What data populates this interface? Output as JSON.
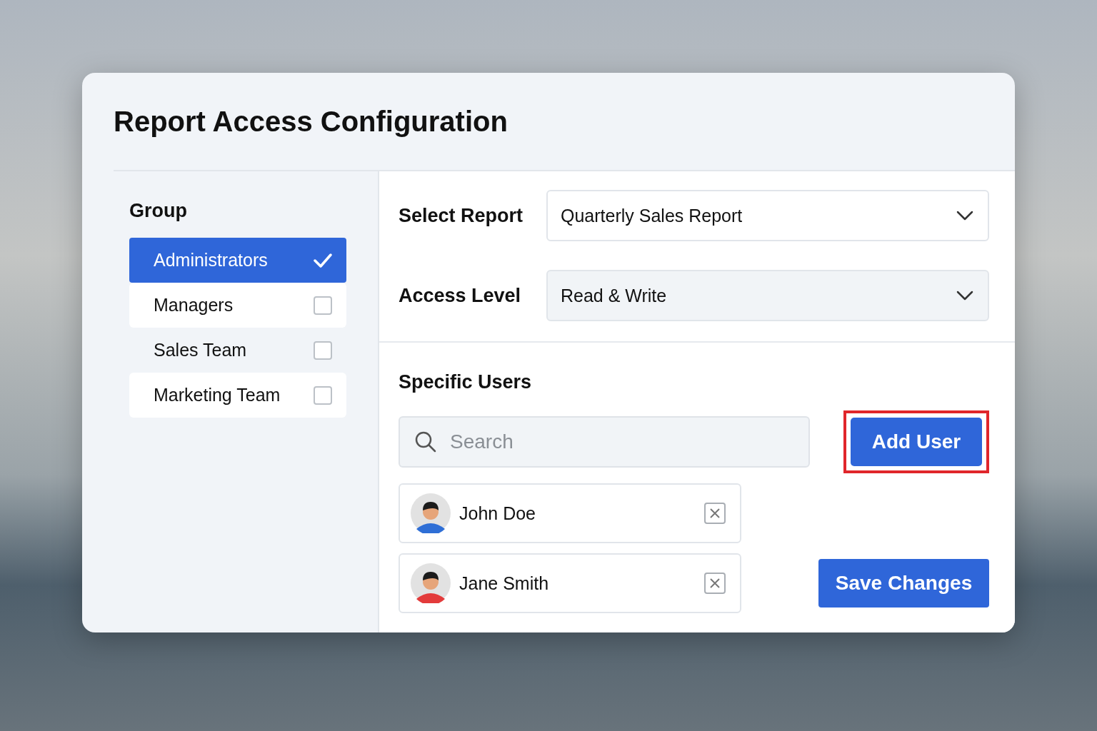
{
  "dialog": {
    "title": "Report Access Configuration"
  },
  "group": {
    "heading": "Group",
    "items": [
      {
        "label": "Administrators",
        "selected": true
      },
      {
        "label": "Managers",
        "selected": false
      },
      {
        "label": "Sales Team",
        "selected": false
      },
      {
        "label": "Marketing Team",
        "selected": false
      }
    ]
  },
  "report_fields": [
    {
      "label": "Select Report",
      "value": "Quarterly Sales Report"
    },
    {
      "label": "Access Level",
      "value": "Read & Write"
    }
  ],
  "specific_users": {
    "heading": "Specific Users",
    "search": {
      "placeholder": "Search"
    },
    "add_button": {
      "label": "Add User",
      "highlighted": true
    },
    "users": [
      {
        "name": "John Doe",
        "color": "#2f6fd6"
      },
      {
        "name": "Jane Smith",
        "color": "#e33b3b"
      }
    ]
  },
  "save_button": "Save Changes"
}
